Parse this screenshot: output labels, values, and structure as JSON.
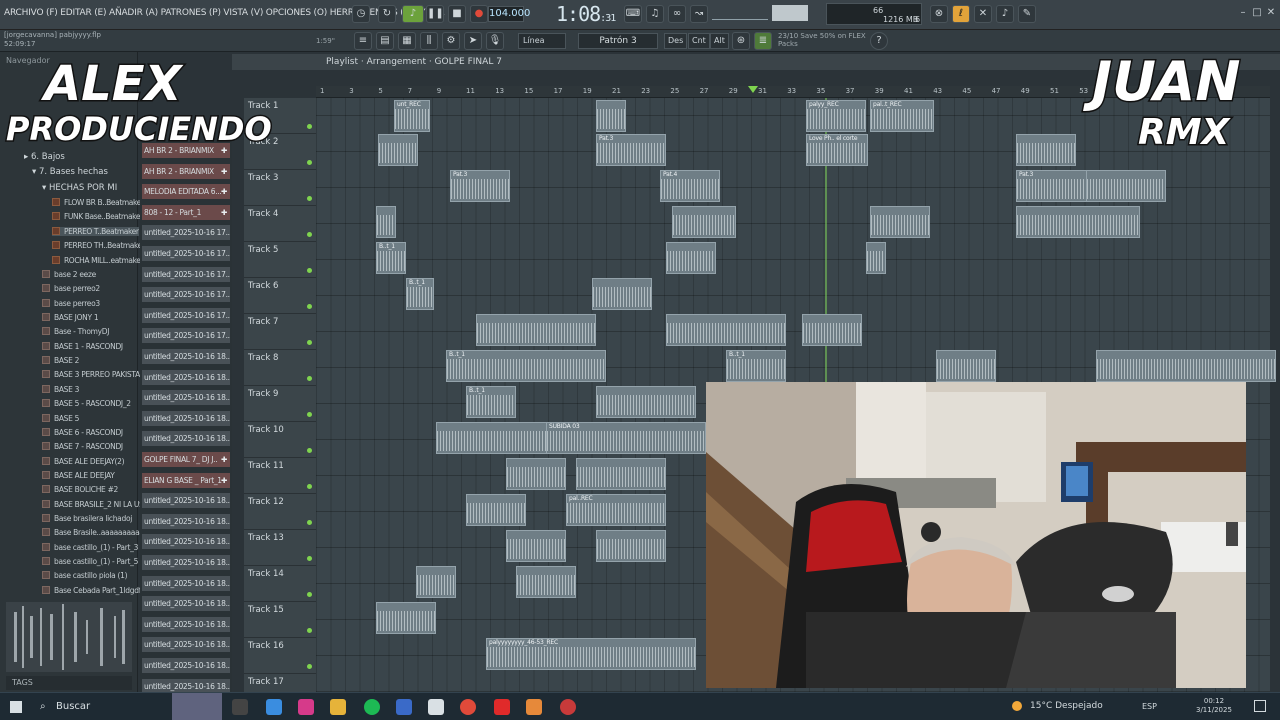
{
  "menu": {
    "text": "ARCHIVO (F) EDITAR (E) AÑADIR (A) PATRONES (P) VISTA (V) OPCIONES (O) HERRAMIENTAS (T) AYUDA"
  },
  "transport": {
    "tempo": "104.000",
    "time": "1:08",
    "time_small": ":31",
    "cpu_mem": "1216 MB",
    "cpu_value": "66",
    "voices": "6"
  },
  "project": {
    "line1": "[jorgecavanna] pabjyyyy.flp",
    "line2": "52:09:17",
    "zoom": "1:59\""
  },
  "toolbar2": {
    "snap": "Línea",
    "pattern": "Patrón 3",
    "btn_des": "Des",
    "btn_cnt": "Cnt",
    "btn_alt": "Alt",
    "hint_line1": "23/10 Save 50% on FLEX",
    "hint_line2": "Packs"
  },
  "browser": {
    "header": "Navegador",
    "folders": [
      {
        "label": "6. Bajos"
      },
      {
        "label": "7. Bases hechas"
      },
      {
        "label": "HECHAS POR MI"
      }
    ],
    "subfiles": [
      "FLOW BR B..Beatmaker",
      "FUNK Base..Beatmaker",
      "PERREO T..Beatmaker",
      "PERREO TH..Beatmaker",
      "ROCHA MILL..eatmaker"
    ],
    "files": [
      "base 2 eeze",
      "base perreo2",
      "base perreo3",
      "BASE JONY 1",
      "Base - ThomyDJ",
      "BASE 1 - RASCONDJ",
      "BASE 2",
      "BASE 3 PERREO PAKISTAN 2",
      "BASE 3",
      "BASE 5 - RASCONDJ_2",
      "BASE 5",
      "BASE 6 - RASCONDJ",
      "BASE 7 - RASCONDJ",
      "BASE ALE DEEJAY(2)",
      "BASE ALE DEEJAY",
      "BASE BOLICHE #2",
      "BASE BRASILE_2 NI LA USE",
      "Base brasilera lichadoj",
      "Base Brasile..aaaaaaaaaa",
      "base castillo_(1) - Part_3",
      "base castillo_(1) - Part_5",
      "base castillo piola (1)",
      "Base Cebada Part_1ldgdf"
    ],
    "tags": "TAGS"
  },
  "patterns": [
    {
      "label": "AH BR 2 - BRIANMIX",
      "type": "pat"
    },
    {
      "label": "AH BR 2 - BRIANMIX",
      "type": "pat"
    },
    {
      "label": "MELODIA EDITADA 6...",
      "type": "pat"
    },
    {
      "label": "808 - 12 - Part_1",
      "type": "pat"
    },
    {
      "label": "untitled_2025-10-16 17..",
      "type": "aud"
    },
    {
      "label": "untitled_2025-10-16 17..",
      "type": "aud"
    },
    {
      "label": "untitled_2025-10-16 17..",
      "type": "aud"
    },
    {
      "label": "untitled_2025-10-16 17..",
      "type": "aud"
    },
    {
      "label": "untitled_2025-10-16 17..",
      "type": "aud"
    },
    {
      "label": "untitled_2025-10-16 17..",
      "type": "aud"
    },
    {
      "label": "untitled_2025-10-16 18..",
      "type": "aud"
    },
    {
      "label": "untitled_2025-10-16 18..",
      "type": "aud"
    },
    {
      "label": "untitled_2025-10-16 18..",
      "type": "aud"
    },
    {
      "label": "untitled_2025-10-16 18..",
      "type": "aud"
    },
    {
      "label": "untitled_2025-10-16 18..",
      "type": "aud"
    },
    {
      "label": "GOLPE FINAL 7_ DJ J..",
      "type": "pat"
    },
    {
      "label": "ELIAN G BASE _ Part_1",
      "type": "pat"
    },
    {
      "label": "untitled_2025-10-16 18..",
      "type": "aud"
    },
    {
      "label": "untitled_2025-10-16 18..",
      "type": "aud"
    },
    {
      "label": "untitled_2025-10-16 18..",
      "type": "aud"
    },
    {
      "label": "untitled_2025-10-16 18..",
      "type": "aud"
    },
    {
      "label": "untitled_2025-10-16 18..",
      "type": "aud"
    },
    {
      "label": "untitled_2025-10-16 18..",
      "type": "aud"
    },
    {
      "label": "untitled_2025-10-16 18..",
      "type": "aud"
    },
    {
      "label": "untitled_2025-10-16 18..",
      "type": "aud"
    },
    {
      "label": "untitled_2025-10-16 18..",
      "type": "aud"
    },
    {
      "label": "untitled_2025-10-16 18..",
      "type": "aud"
    }
  ],
  "playlist": {
    "title": "Playlist · Arrangement · GOLPE FINAL 7"
  },
  "ruler": [
    "1",
    "3",
    "5",
    "7",
    "9",
    "11",
    "13",
    "15",
    "17",
    "19",
    "21",
    "23",
    "25",
    "27",
    "29",
    "31",
    "33",
    "35",
    "37",
    "39",
    "41",
    "43",
    "45",
    "47",
    "49",
    "51",
    "53"
  ],
  "tracks": [
    "Track 1",
    "Track 2",
    "Track 3",
    "Track 4",
    "Track 5",
    "Track 6",
    "Track 7",
    "Track 8",
    "Track 9",
    "Track 10",
    "Track 11",
    "Track 12",
    "Track 13",
    "Track 14",
    "Track 15",
    "Track 16",
    "Track 17"
  ],
  "clip_labels": [
    "unt_REC",
    "palyy_REC",
    "pal..t_REC",
    "Pat.3",
    "Pat.3",
    "Love Ph.. el corte",
    "Pat.4",
    "Pat.3",
    "B..t_1",
    "SUBIDA 03",
    "pal..REC",
    "palyyyyyyyy_46-53_REC"
  ],
  "overlay": {
    "left_logo_line1": "ALEX",
    "left_logo_line2": "PRODUCIENDO",
    "right_logo_line1": "JUAN",
    "right_logo_line2": "RMX"
  },
  "taskbar": {
    "search": "Buscar",
    "weather": "15°C Despejado",
    "lang": "ESP",
    "time": "00:12",
    "date": "3/11/2025"
  }
}
